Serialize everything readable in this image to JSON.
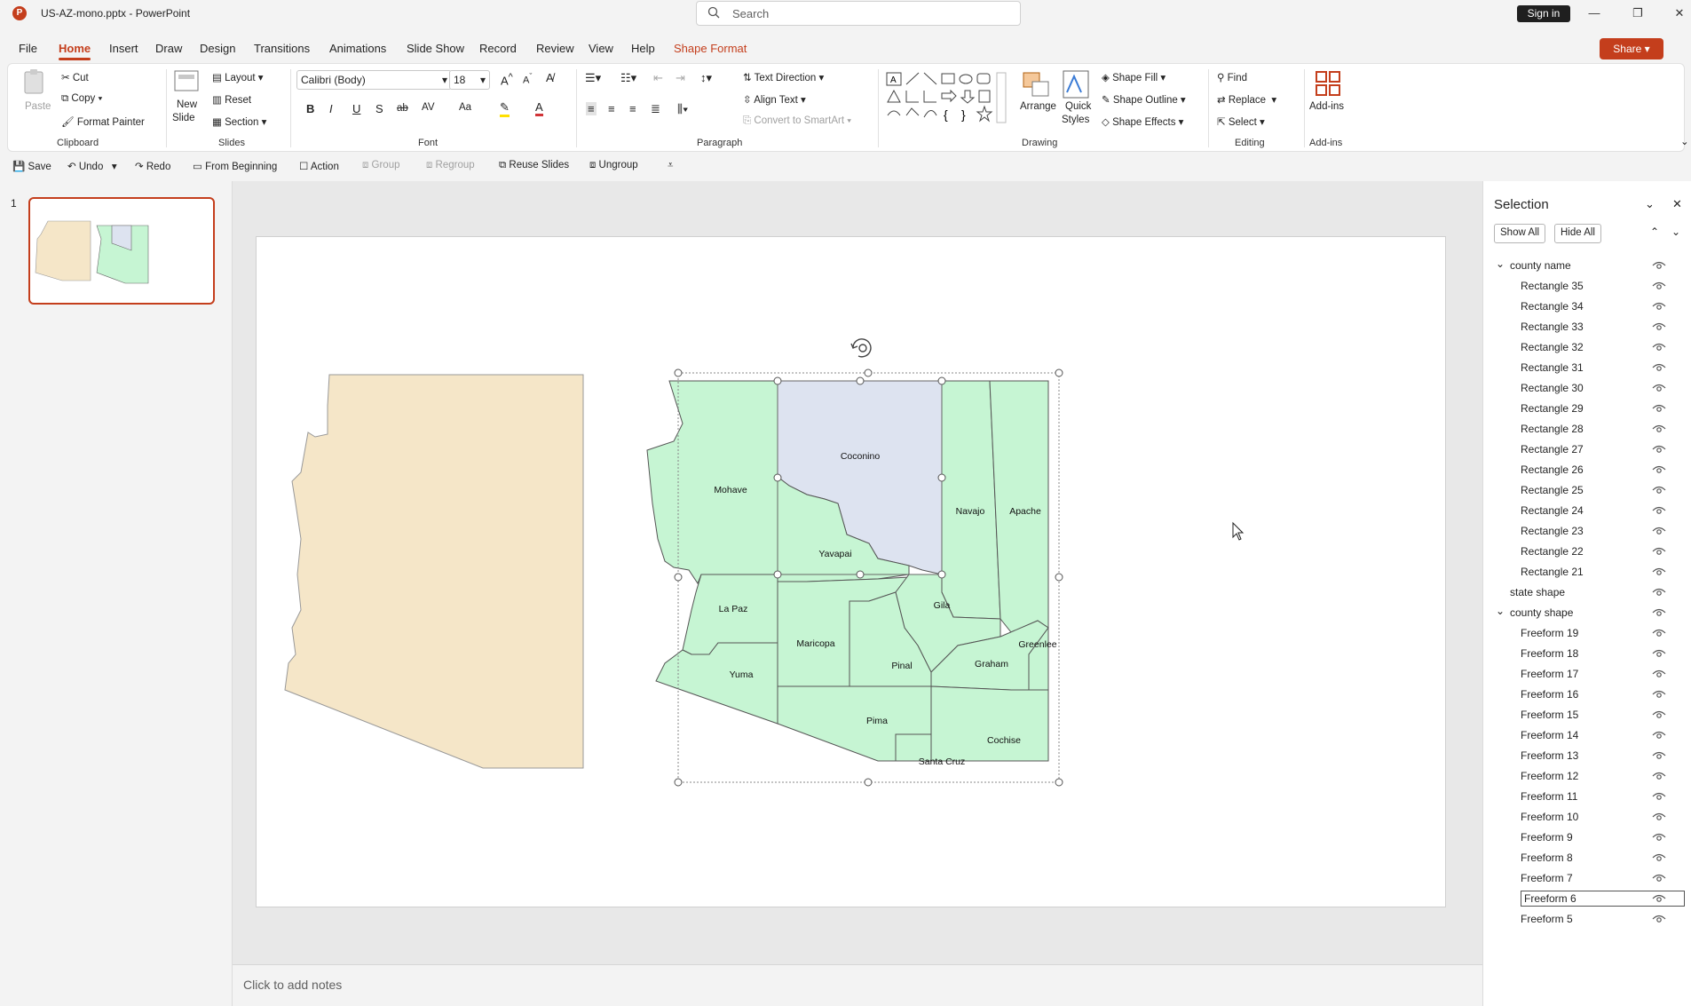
{
  "titlebar": {
    "app_logo": "P",
    "doc_title": "US-AZ-mono.pptx  -  PowerPoint",
    "search_placeholder": "Search",
    "sign_in": "Sign in",
    "min": "—",
    "restore": "❐",
    "close": "✕"
  },
  "menu": {
    "tabs": [
      "File",
      "Home",
      "Insert",
      "Draw",
      "Design",
      "Transitions",
      "Animations",
      "Slide Show",
      "Record",
      "Review",
      "View",
      "Help",
      "Shape Format"
    ],
    "share": "Share"
  },
  "ribbon": {
    "clipboard": {
      "paste": "Paste",
      "cut": "Cut",
      "copy": "Copy",
      "format_painter": "Format Painter",
      "label": "Clipboard"
    },
    "slides": {
      "new_slide": "New",
      "new_slide2": "Slide",
      "layout": "Layout",
      "reset": "Reset",
      "section": "Section",
      "label": "Slides"
    },
    "font": {
      "family": "Calibri (Body)",
      "size": "18",
      "label": "Font",
      "bold": "B",
      "italic": "I",
      "underline": "U",
      "shadow": "S",
      "strike": "ab",
      "spacing": "AV",
      "case": "Aa"
    },
    "paragraph": {
      "text_direction": "Text Direction",
      "align_text": "Align Text",
      "smartart": "Convert to SmartArt",
      "label": "Paragraph"
    },
    "drawing": {
      "arrange": "Arrange",
      "quick_styles": "Quick",
      "quick_styles2": "Styles",
      "shape_fill": "Shape Fill",
      "shape_outline": "Shape Outline",
      "shape_effects": "Shape Effects",
      "label": "Drawing"
    },
    "editing": {
      "find": "Find",
      "replace": "Replace",
      "select": "Select",
      "label": "Editing"
    },
    "addins": {
      "addins": "Add-ins",
      "label": "Add-ins"
    }
  },
  "qat": {
    "save": "Save",
    "undo": "Undo",
    "redo": "Redo",
    "from_beginning": "From Beginning",
    "action": "Action",
    "group": "Group",
    "regroup": "Regroup",
    "reuse_slides": "Reuse Slides",
    "ungroup": "Ungroup"
  },
  "thumbnails": {
    "slide_number": "1"
  },
  "slide": {
    "counties": [
      "Mohave",
      "Coconino",
      "Navajo",
      "Apache",
      "Yavapai",
      "La Paz",
      "Gila",
      "Maricopa",
      "Pinal",
      "Greenlee",
      "Graham",
      "Yuma",
      "Pima",
      "Cochise",
      "Santa Cruz"
    ]
  },
  "notes": {
    "placeholder": "Click to add notes"
  },
  "selection_pane": {
    "title": "Selection",
    "show_all": "Show All",
    "hide_all": "Hide All",
    "items": [
      {
        "label": "county name",
        "level": 0,
        "group": true
      },
      {
        "label": "Rectangle 35",
        "level": 1
      },
      {
        "label": "Rectangle 34",
        "level": 1
      },
      {
        "label": "Rectangle 33",
        "level": 1
      },
      {
        "label": "Rectangle 32",
        "level": 1
      },
      {
        "label": "Rectangle 31",
        "level": 1
      },
      {
        "label": "Rectangle 30",
        "level": 1
      },
      {
        "label": "Rectangle 29",
        "level": 1
      },
      {
        "label": "Rectangle 28",
        "level": 1
      },
      {
        "label": "Rectangle 27",
        "level": 1
      },
      {
        "label": "Rectangle 26",
        "level": 1
      },
      {
        "label": "Rectangle 25",
        "level": 1
      },
      {
        "label": "Rectangle 24",
        "level": 1
      },
      {
        "label": "Rectangle 23",
        "level": 1
      },
      {
        "label": "Rectangle 22",
        "level": 1
      },
      {
        "label": "Rectangle 21",
        "level": 1
      },
      {
        "label": "state shape",
        "level": 0,
        "group": false
      },
      {
        "label": "county shape",
        "level": 0,
        "group": true
      },
      {
        "label": "Freeform 19",
        "level": 1
      },
      {
        "label": "Freeform 18",
        "level": 1
      },
      {
        "label": "Freeform 17",
        "level": 1
      },
      {
        "label": "Freeform 16",
        "level": 1
      },
      {
        "label": "Freeform 15",
        "level": 1
      },
      {
        "label": "Freeform 14",
        "level": 1
      },
      {
        "label": "Freeform 13",
        "level": 1
      },
      {
        "label": "Freeform 12",
        "level": 1
      },
      {
        "label": "Freeform 11",
        "level": 1
      },
      {
        "label": "Freeform 10",
        "level": 1
      },
      {
        "label": "Freeform 9",
        "level": 1
      },
      {
        "label": "Freeform 8",
        "level": 1
      },
      {
        "label": "Freeform 7",
        "level": 1
      },
      {
        "label": "Freeform 6",
        "level": 1,
        "selected": true
      },
      {
        "label": "Freeform 5",
        "level": 1
      }
    ]
  },
  "colors": {
    "accent": "#c43e1c",
    "state_fill": "#f5e6c8",
    "county_fill": "#c6f5d3",
    "selected_county_fill": "#dde3f0"
  }
}
